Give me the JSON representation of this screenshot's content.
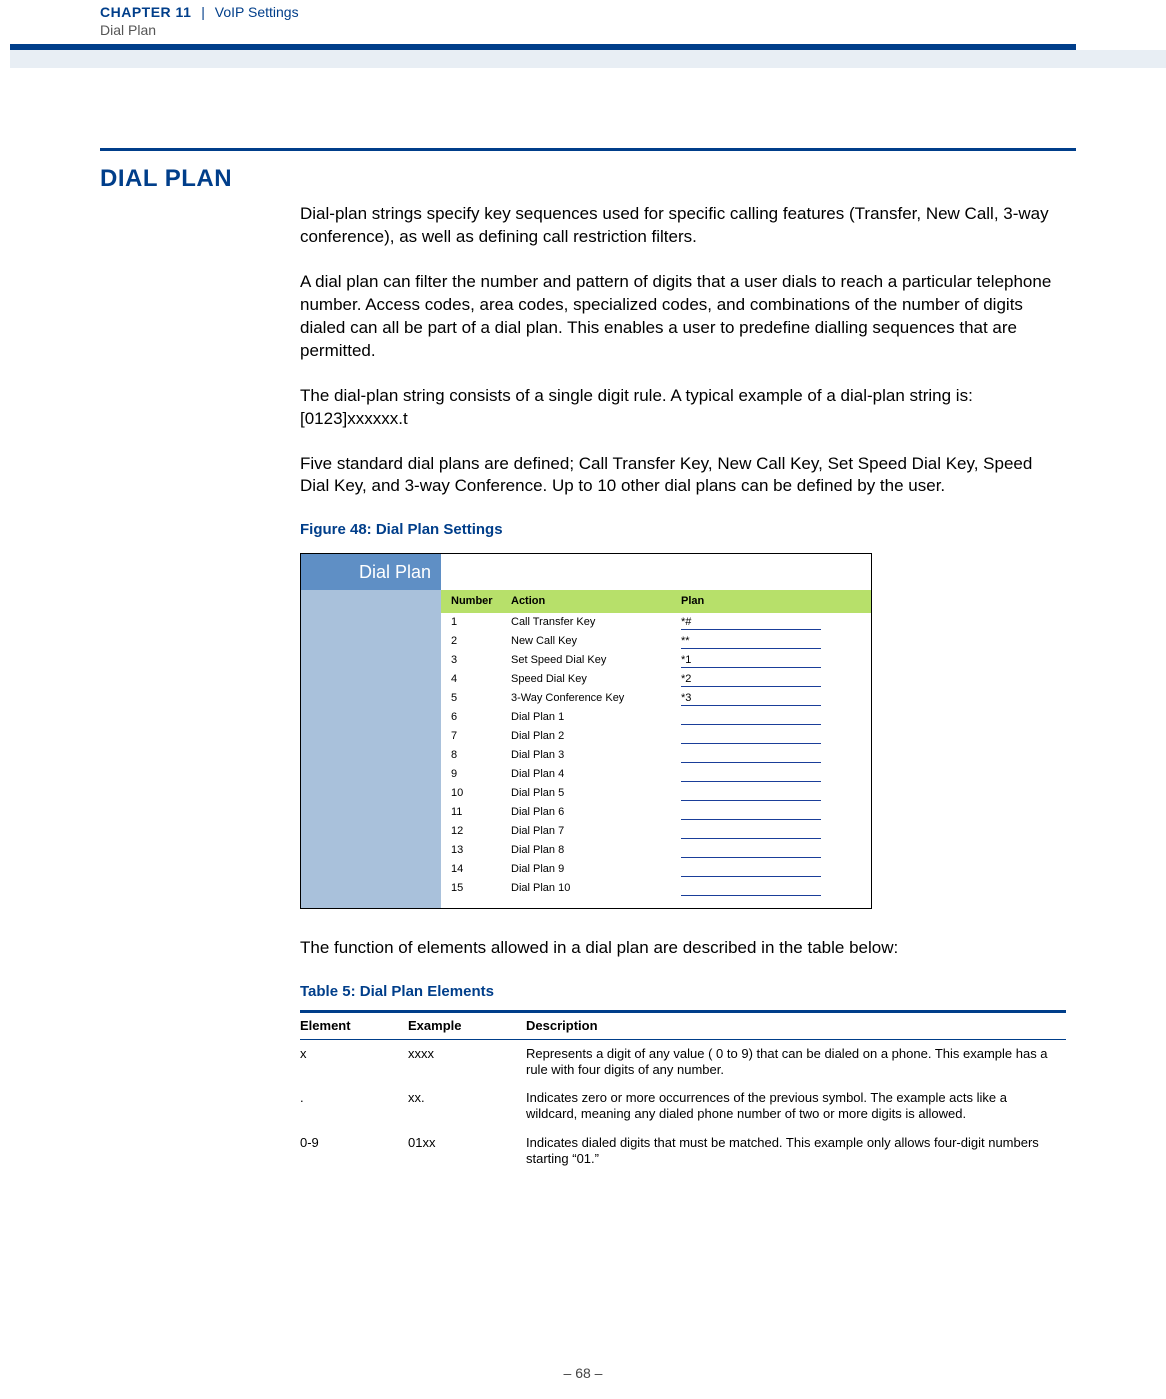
{
  "header": {
    "chapter": "CHAPTER 11",
    "separator": "|",
    "section": "VoIP Settings",
    "subsection": "Dial Plan"
  },
  "section_title": "DIAL PLAN",
  "paragraphs": {
    "p1": "Dial-plan strings specify key sequences used for specific calling features (Transfer, New Call, 3-way conference), as well as defining call restriction filters.",
    "p2": "A dial plan can filter the number and pattern of digits that a user dials to reach a particular telephone number. Access codes, area codes, specialized codes, and combinations of the number of digits dialed can all be part of a dial plan. This enables a user to predefine dialling sequences that are permitted.",
    "p3": "The dial-plan string consists of a single digit rule. A typical example of a dial-plan string is: [0123]xxxxxx.t",
    "p4": "Five standard dial plans are defined; Call Transfer Key, New Call Key, Set Speed Dial Key, Speed Dial Key, and 3-way Conference. Up to 10 other dial plans can be defined by the user.",
    "p5": "The function of elements allowed in a dial plan are described in the table below:"
  },
  "figure_caption": "Figure 48:  Dial Plan Settings",
  "screenshot": {
    "panel_title": "Dial Plan",
    "headers": {
      "number": "Number",
      "action": "Action",
      "plan": "Plan"
    },
    "rows": [
      {
        "num": "1",
        "action": "Call Transfer Key",
        "plan": "*#"
      },
      {
        "num": "2",
        "action": "New Call Key",
        "plan": "**"
      },
      {
        "num": "3",
        "action": "Set Speed Dial Key",
        "plan": "*1"
      },
      {
        "num": "4",
        "action": "Speed Dial Key",
        "plan": "*2"
      },
      {
        "num": "5",
        "action": "3-Way Conference Key",
        "plan": "*3"
      },
      {
        "num": "6",
        "action": "Dial Plan 1",
        "plan": ""
      },
      {
        "num": "7",
        "action": "Dial Plan 2",
        "plan": ""
      },
      {
        "num": "8",
        "action": "Dial Plan 3",
        "plan": ""
      },
      {
        "num": "9",
        "action": "Dial Plan 4",
        "plan": ""
      },
      {
        "num": "10",
        "action": "Dial Plan 5",
        "plan": ""
      },
      {
        "num": "11",
        "action": "Dial Plan 6",
        "plan": ""
      },
      {
        "num": "12",
        "action": "Dial Plan 7",
        "plan": ""
      },
      {
        "num": "13",
        "action": "Dial Plan 8",
        "plan": ""
      },
      {
        "num": "14",
        "action": "Dial Plan 9",
        "plan": ""
      },
      {
        "num": "15",
        "action": "Dial Plan 10",
        "plan": ""
      }
    ]
  },
  "table_caption": "Table 5: Dial Plan Elements",
  "elements_table": {
    "headers": {
      "element": "Element",
      "example": "Example",
      "description": "Description"
    },
    "rows": [
      {
        "element": "x",
        "example": "xxxx",
        "description": "Represents a digit of any value ( 0 to 9) that can be dialed on a phone. This example has a rule with four digits of any number."
      },
      {
        "element": ".",
        "example": "xx.",
        "description": "Indicates zero or more occurrences of the previous symbol. The example acts like a wildcard, meaning any dialed phone number of two or more digits is allowed."
      },
      {
        "element": "0-9",
        "example": "01xx",
        "description": "Indicates dialed digits that must be matched. This example only allows four-digit numbers starting “01.”"
      }
    ]
  },
  "footer": "–  68  –"
}
